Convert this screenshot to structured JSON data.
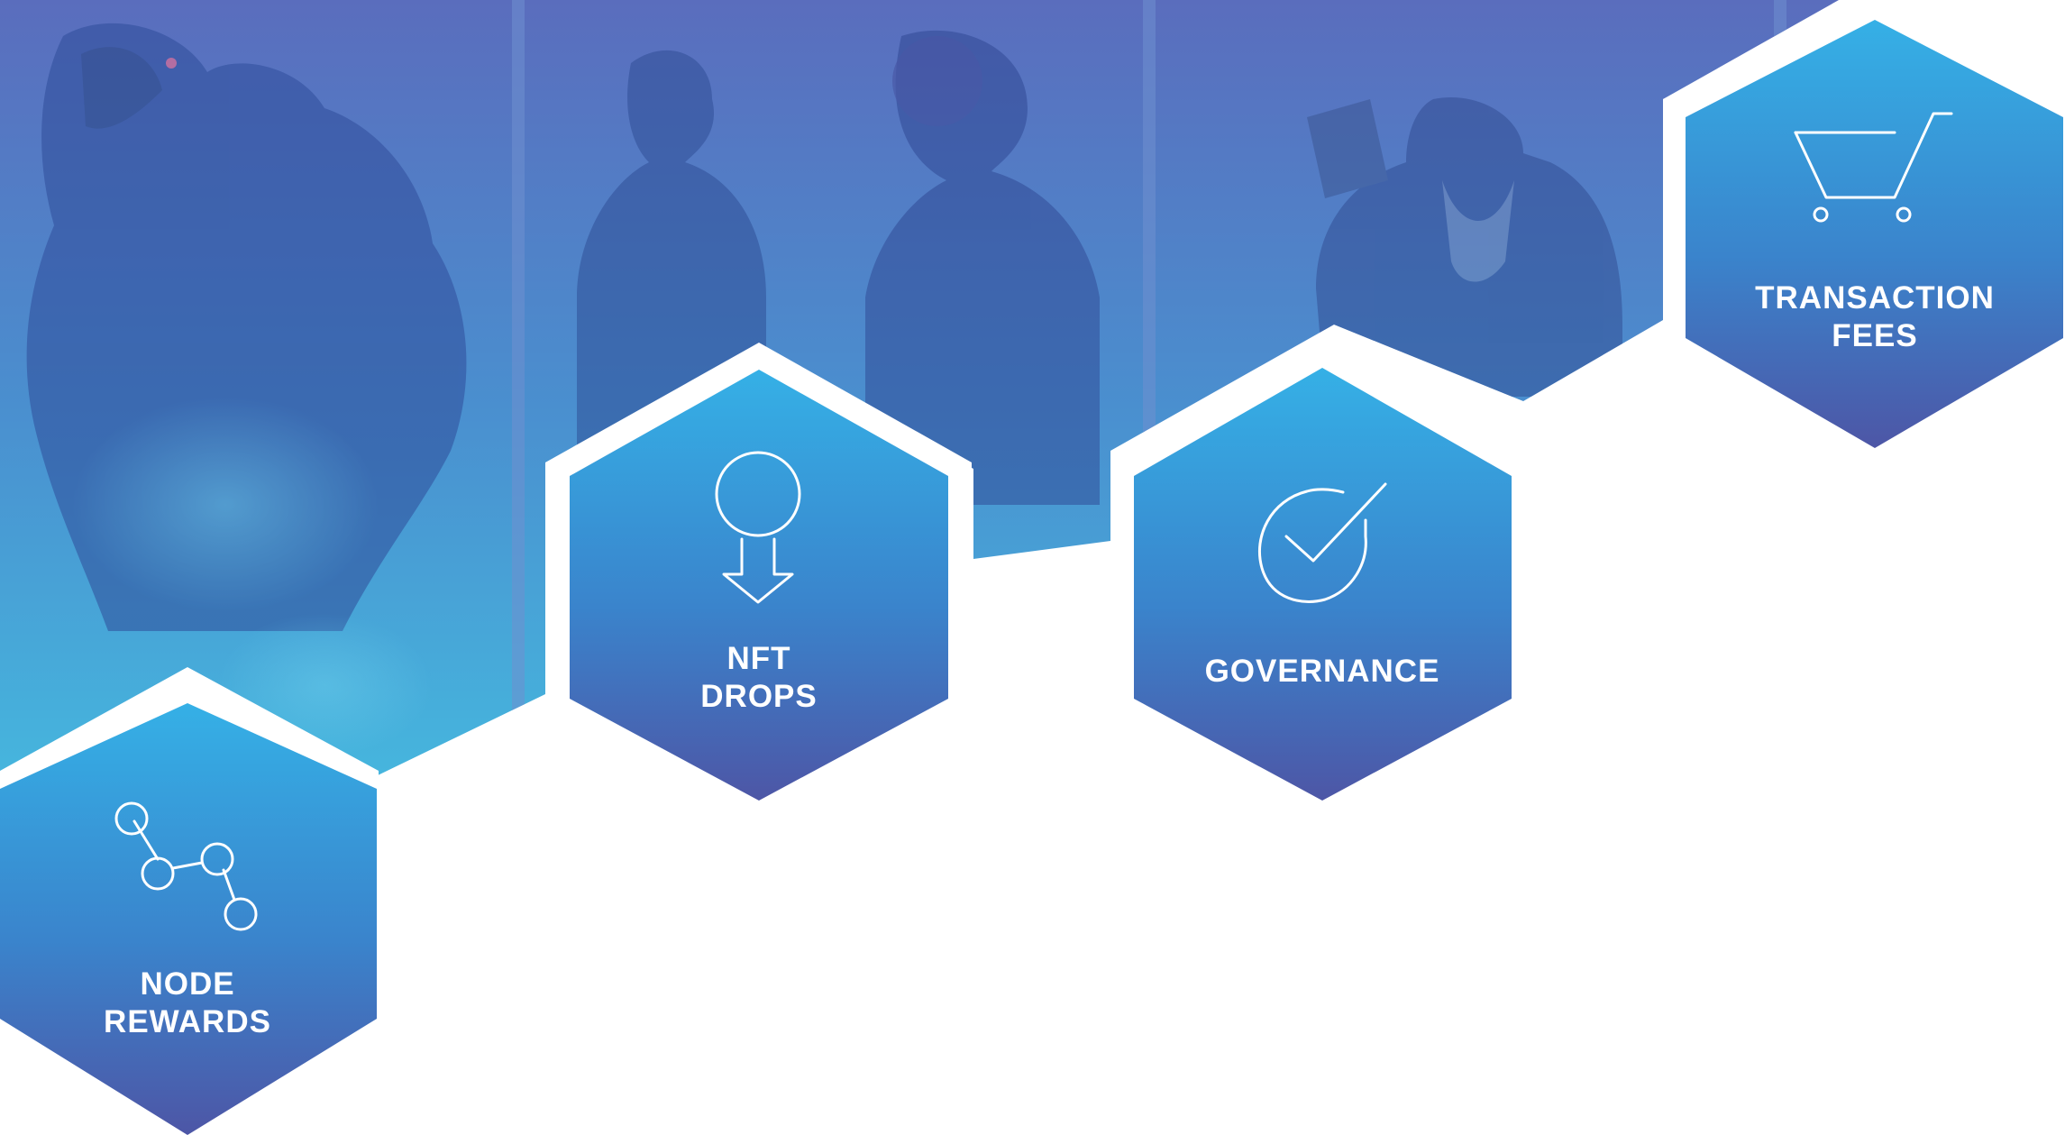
{
  "colors": {
    "hex_top": "#35b0e6",
    "hex_bottom": "#4a5fab",
    "art_tint_top": "#5b6fbe",
    "art_tint_bottom": "#3bbde0",
    "background": "#ffffff"
  },
  "hexes": [
    {
      "id": "node-rewards",
      "label_line1": "NODE",
      "label_line2": "REWARDS",
      "icon": "node-graph-icon"
    },
    {
      "id": "nft-drops",
      "label_line1": "NFT",
      "label_line2": "DROPS",
      "icon": "drop-pin-icon"
    },
    {
      "id": "governance",
      "label_line1": "GOVERNANCE",
      "icon": "checkmark-icon"
    },
    {
      "id": "transaction-fees",
      "label_line1": "TRANSACTION",
      "label_line2": "FEES",
      "icon": "shopping-cart-icon"
    }
  ],
  "background_art": {
    "panels": [
      "werewolf-illustration",
      "heroes-illustration",
      "bearded-warrior-illustration"
    ]
  }
}
